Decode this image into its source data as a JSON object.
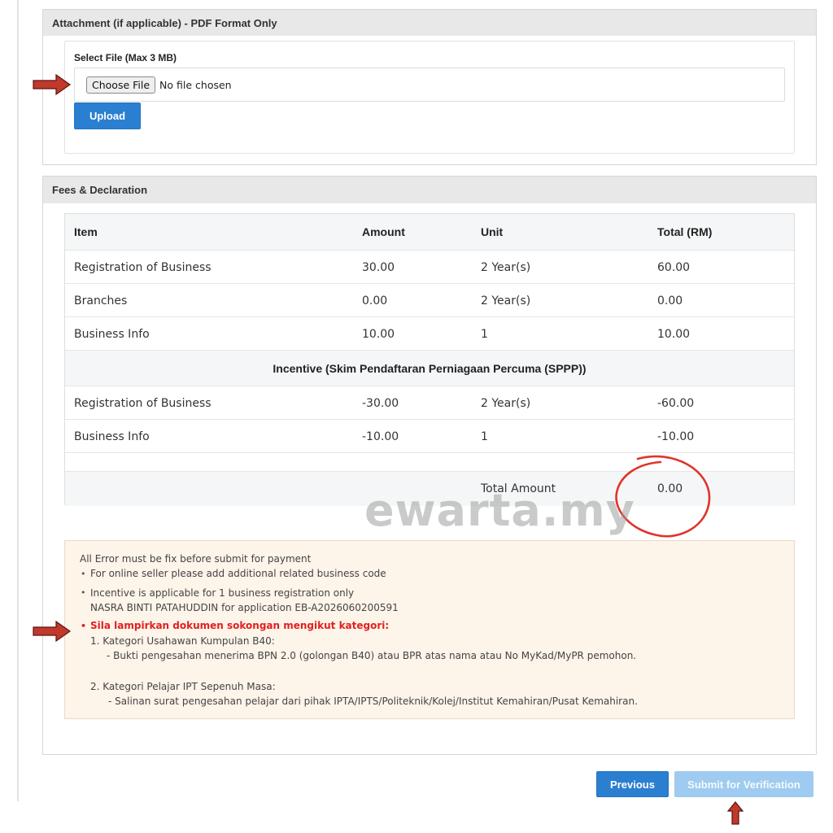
{
  "attachment": {
    "header": "Attachment (if applicable) - PDF Format Only",
    "file_label": "Select File (Max 3 MB)",
    "choose_button": "Choose File",
    "no_file_text": "No file chosen",
    "upload_button": "Upload"
  },
  "fees": {
    "header": "Fees & Declaration",
    "columns": [
      "Item",
      "Amount",
      "Unit",
      "Total (RM)"
    ],
    "rows": [
      [
        "Registration of Business",
        "30.00",
        "2 Year(s)",
        "60.00"
      ],
      [
        "Branches",
        "0.00",
        "2 Year(s)",
        "0.00"
      ],
      [
        "Business Info",
        "10.00",
        "1",
        "10.00"
      ]
    ],
    "incentive_title": "Incentive (Skim Pendaftaran Perniagaan Percuma (SPPP))",
    "incentive_rows": [
      [
        "Registration of Business",
        "-30.00",
        "2 Year(s)",
        "-60.00"
      ],
      [
        "Business Info",
        "-10.00",
        "1",
        "-10.00"
      ]
    ],
    "total_label": "Total Amount",
    "total_value": "0.00"
  },
  "notes": {
    "intro": "All Error must be fix before submit for payment",
    "bullet1": "For online seller please add additional related business code",
    "bullet2_line1": "Incentive is applicable for 1 business registration only",
    "bullet2_line2": "NASRA BINTI PATAHUDDIN for application EB-A2026060200591",
    "bullet3_red": "Sila lampirkan dokumen sokongan mengikut kategori:",
    "cat1_title": "1. Kategori Usahawan Kumpulan B40:",
    "cat1_detail": "- Bukti pengesahan menerima BPN 2.0 (golongan B40) atau BPR atas nama atau No MyKad/MyPR pemohon.",
    "cat2_title": "2. Kategori Pelajar IPT Sepenuh Masa:",
    "cat2_detail": "- Salinan surat pengesahan pelajar dari pihak IPTA/IPTS/Politeknik/Kolej/Institut Kemahiran/Pusat Kemahiran."
  },
  "actions": {
    "previous": "Previous",
    "submit": "Submit for Verification"
  },
  "watermark": "ewarta.my",
  "colors": {
    "primary_button": "#2b7fd0",
    "disabled_button": "#9fcbf0",
    "annotation_red": "#e0342c",
    "arrow_red": "#c0392b"
  }
}
